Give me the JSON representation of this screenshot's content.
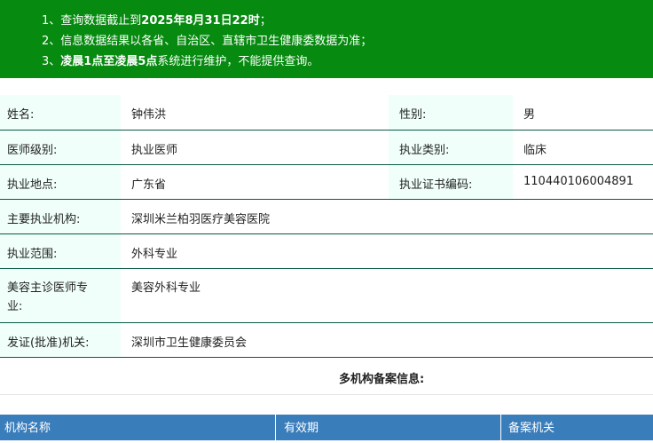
{
  "notice": {
    "line1_prefix": "1、查询数据截止到",
    "line1_bold": "2025年8月31日22时",
    "line1_suffix": "；",
    "line2": "2、信息数据结果以各省、自治区、直辖市卫生健康委数据为准；",
    "line3_prefix": "3、",
    "line3_bold": "凌晨1点至凌晨5点",
    "line3_suffix": "系统进行维护，不能提供查询。"
  },
  "info": {
    "name_label": "姓名:",
    "name_value": "钟伟洪",
    "gender_label": "性别:",
    "gender_value": "男",
    "level_label": "医师级别:",
    "level_value": "执业医师",
    "category_label": "执业类别:",
    "category_value": "临床",
    "location_label": "执业地点:",
    "location_value": "广东省",
    "cert_label": "执业证书编码:",
    "cert_value": "110440106004891",
    "institution_label": "主要执业机构:",
    "institution_value": "深圳米兰柏羽医疗美容医院",
    "scope_label": "执业范围:",
    "scope_value": "外科专业",
    "cosmetic_label_line1": "美容主诊医师专",
    "cosmetic_label_line2": "业:",
    "cosmetic_value": "美容外科专业",
    "issuer_label": "发证(批准)机关:",
    "issuer_value": "深圳市卫生健康委员会"
  },
  "multi": {
    "title": "多机构备案信息:",
    "col_institution": "机构名称",
    "col_validity": "有效期",
    "col_authority": "备案机关"
  }
}
